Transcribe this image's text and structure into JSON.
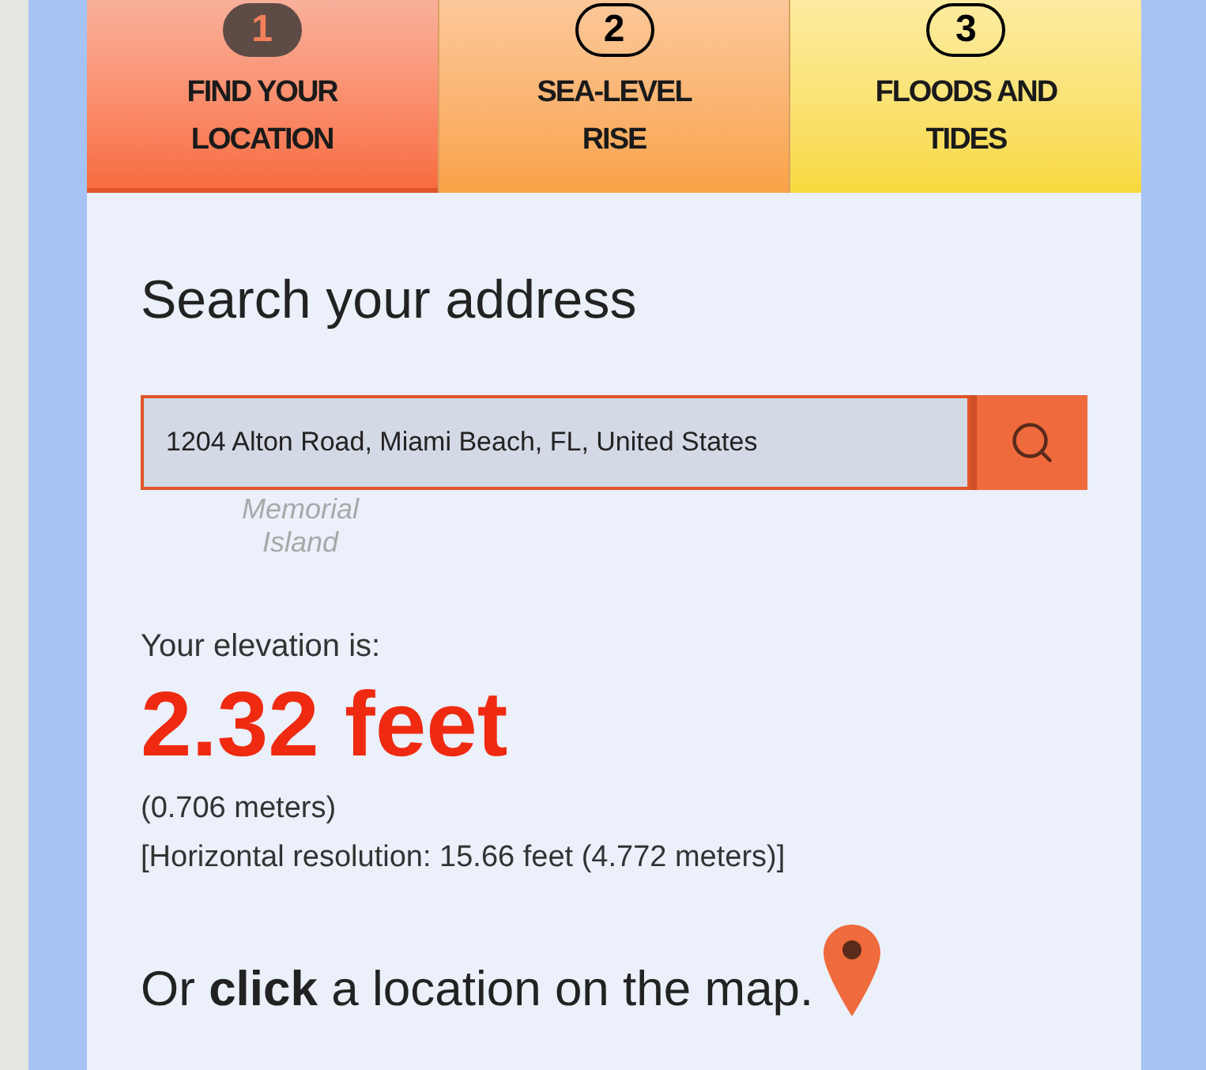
{
  "tabs": [
    {
      "number": "1",
      "label": "FIND YOUR LOCATION",
      "selected": true,
      "kind": "red"
    },
    {
      "number": "2",
      "label": "SEA-LEVEL RISE",
      "selected": false,
      "kind": "orange"
    },
    {
      "number": "3",
      "label": "FLOODS AND TIDES",
      "selected": false,
      "kind": "yellow"
    }
  ],
  "heading": "Search your address",
  "search": {
    "value": "1204 Alton Road, Miami Beach, FL, United States"
  },
  "map_label": [
    "Memorial",
    "Island"
  ],
  "elevation": {
    "label": "Your elevation is:",
    "value": "2.32 feet",
    "meters": "(0.706 meters)",
    "resolution": "[Horizontal resolution: 15.66 feet (4.772 meters)]"
  },
  "map_hint": "Or **click** a location on the map."
}
